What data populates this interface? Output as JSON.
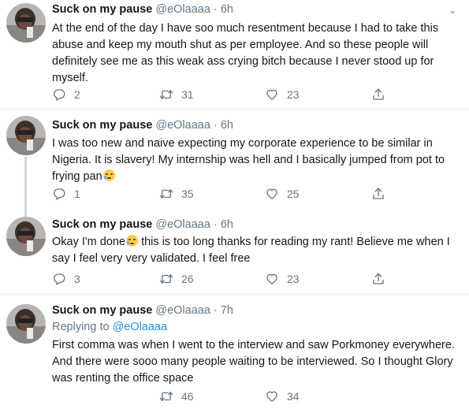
{
  "tweets": [
    {
      "name": "Suck on my pause",
      "handle": "@eOlaaaa",
      "time": "6h",
      "text": "At the end of the day I have soo much resentment because I had to take this abuse and keep my mouth shut as per employee. And so these people will definitely see me as this weak ass crying bitch because I never stood up for myself.",
      "replies": "2",
      "retweets": "31",
      "likes": "23"
    },
    {
      "name": "Suck on my pause",
      "handle": "@eOlaaaa",
      "time": "6h",
      "text": "I was too new and naive expecting my corporate experience to be similar in Nigeria. It is slavery! My internship was hell and I basically jumped from pot to frying pan",
      "emoji": "sad-tear-emoji",
      "replies": "1",
      "retweets": "35",
      "likes": "25"
    },
    {
      "name": "Suck on my pause",
      "handle": "@eOlaaaa",
      "time": "6h",
      "text_before": "Okay I'm done",
      "emoji": "crying-emoji",
      "text_after": " this is too long thanks for reading my rant! Believe me when I say I feel very very validated. I feel free",
      "replies": "3",
      "retweets": "26",
      "likes": "23"
    },
    {
      "name": "Suck on my pause",
      "handle": "@eOlaaaa",
      "time": "7h",
      "replying_label": "Replying to",
      "replying_handle": "@eOlaaaa",
      "text": "First comma was when I went to the interview and saw Porkmoney everywhere. And there were sooo many people waiting to be interviewed. So I thought Glory was renting the office space",
      "retweets": "46",
      "likes": "34"
    }
  ],
  "dot": "·",
  "icons": {
    "reply": "reply-icon",
    "retweet": "retweet-icon",
    "like": "heart-icon",
    "share": "share-icon",
    "caret": "chevron-down-icon"
  },
  "colors": {
    "muted": "#657786",
    "link": "#1b95e0",
    "thread": "#ccd6dd"
  }
}
